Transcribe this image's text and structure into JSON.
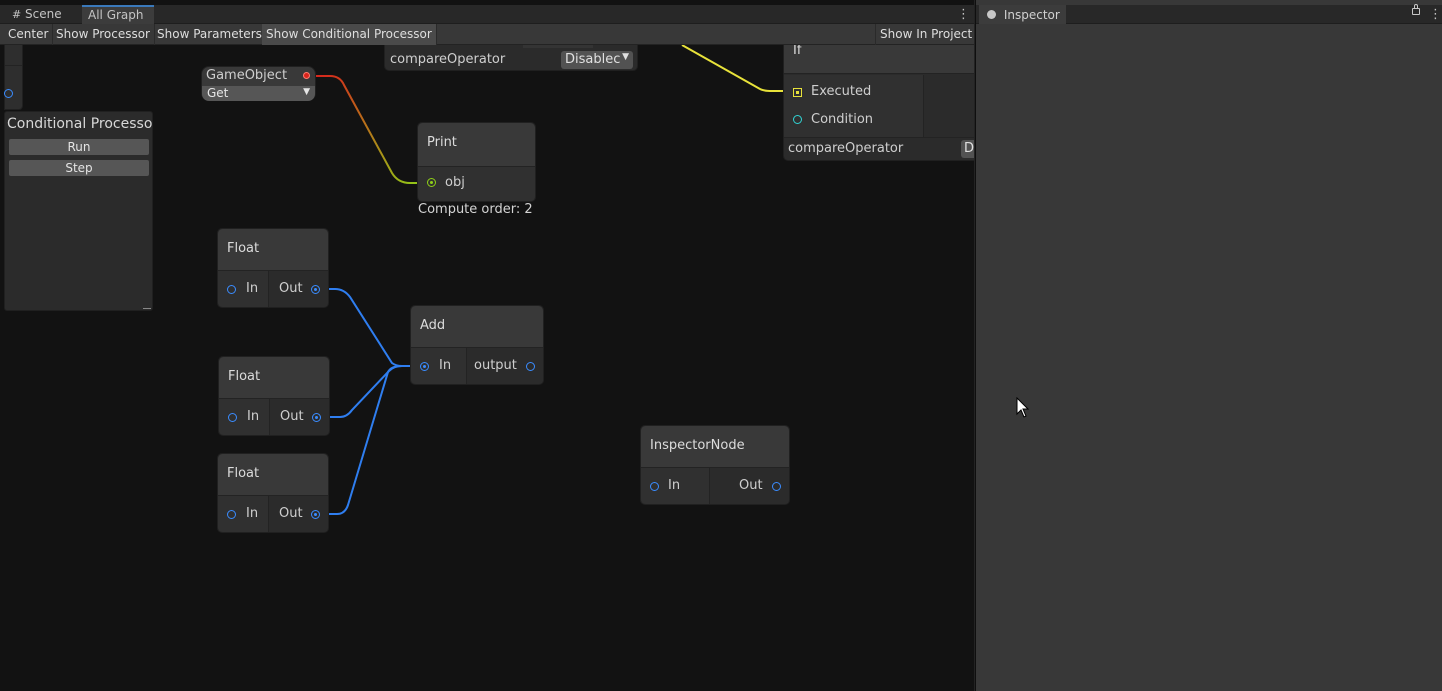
{
  "tabs": {
    "scene": "Scene",
    "all_graph": "All Graph"
  },
  "toolbar": {
    "center": "Center",
    "show_processor": "Show Processor",
    "show_parameters": "Show Parameters",
    "show_conditional_processor": "Show Conditional Processor",
    "show_in_project": "Show In Project"
  },
  "nodes": {
    "compare_top": {
      "label": "compareOperator",
      "value": "Disablec"
    },
    "gameobject": {
      "title": "GameObject",
      "mode": "Get"
    },
    "conditional": {
      "title": "Conditional Processo",
      "run": "Run",
      "step": "Step"
    },
    "print": {
      "title": "Print",
      "port": "obj",
      "compute_order": "Compute order: 2"
    },
    "if": {
      "title": "If",
      "executed": "Executed",
      "condition": "Condition",
      "compare_label": "compareOperator",
      "compare_value": "D"
    },
    "float1": {
      "title": "Float",
      "in": "In",
      "out": "Out"
    },
    "float2": {
      "title": "Float",
      "in": "In",
      "out": "Out"
    },
    "float3": {
      "title": "Float",
      "in": "In",
      "out": "Out"
    },
    "add": {
      "title": "Add",
      "in": "In",
      "out": "output"
    },
    "inspector_node": {
      "title": "InspectorNode",
      "in": "In",
      "out": "Out"
    }
  },
  "inspector": {
    "title": "Inspector"
  },
  "colors": {
    "accent": "#3a79bb",
    "float_edge": "#2f7ef0",
    "exec_edge": "#e8e23a",
    "object_edge_start": "#d8241c",
    "object_edge_end": "#8ed017"
  }
}
